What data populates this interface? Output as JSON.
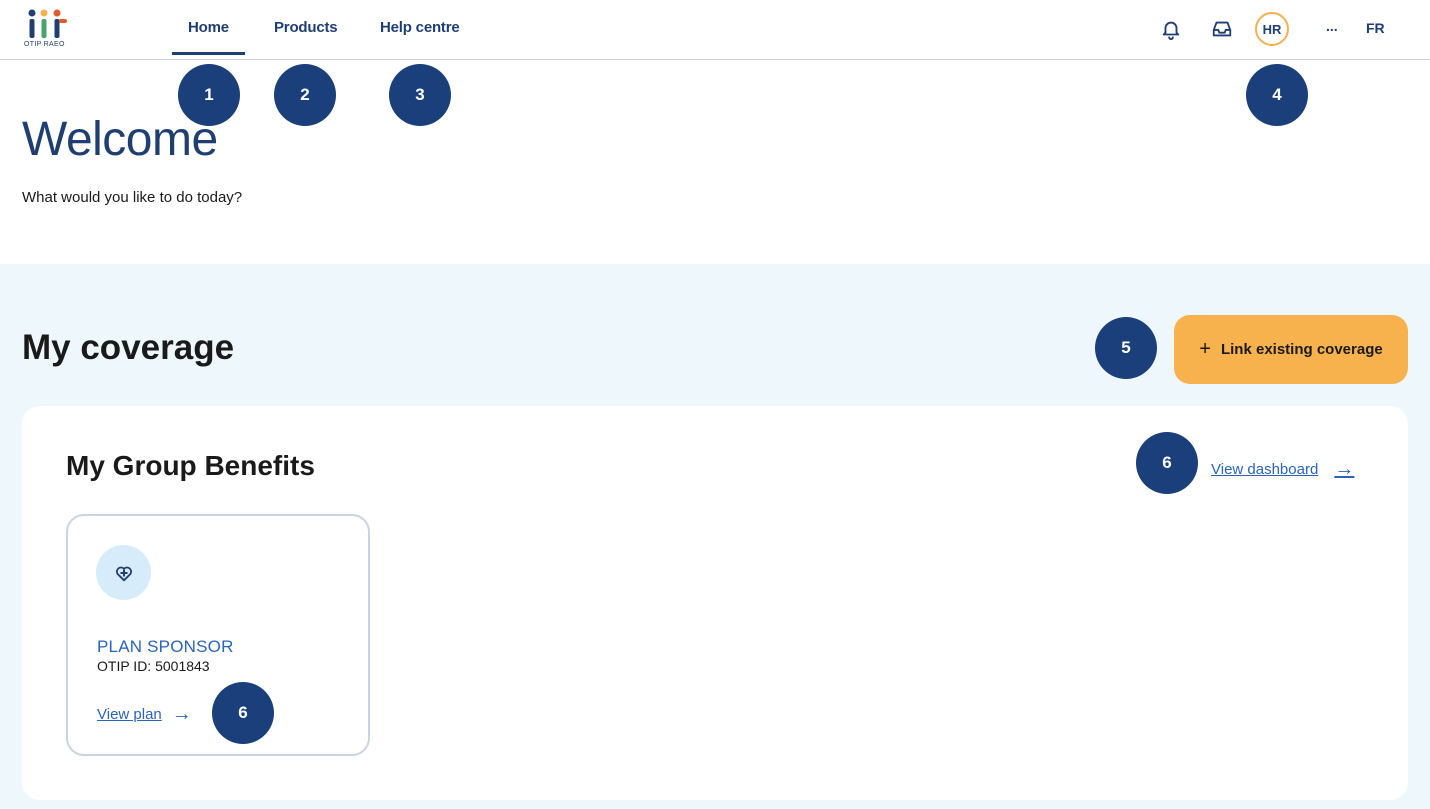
{
  "brand": {
    "logo_text": "OTIP RAEO",
    "primary_color": "#1f3f72",
    "accent_color": "#f8b24d",
    "link_color": "#2a64b8"
  },
  "nav": {
    "items": [
      {
        "label": "Home",
        "active": true
      },
      {
        "label": "Products"
      },
      {
        "label": "Help centre"
      }
    ]
  },
  "header_right": {
    "bell_icon": "bell-icon",
    "inbox_icon": "inbox-icon",
    "avatar_initials": "HR",
    "more": "...",
    "language": "FR"
  },
  "markers": [
    "1",
    "2",
    "3",
    "4",
    "5",
    "6",
    "6"
  ],
  "welcome": {
    "title": "Welcome",
    "subtitle": "What would you like to do today?"
  },
  "coverage": {
    "title": "My coverage",
    "link_button": "Link existing coverage",
    "link_button_icon": "plus-icon",
    "group_benefits": {
      "title": "My Group Benefits",
      "view_dashboard": "View dashboard",
      "plan": {
        "icon": "medical-heart-icon",
        "role": "PLAN SPONSOR",
        "otip_id": "OTIP ID: 5001843",
        "view_plan": "View plan"
      }
    }
  }
}
